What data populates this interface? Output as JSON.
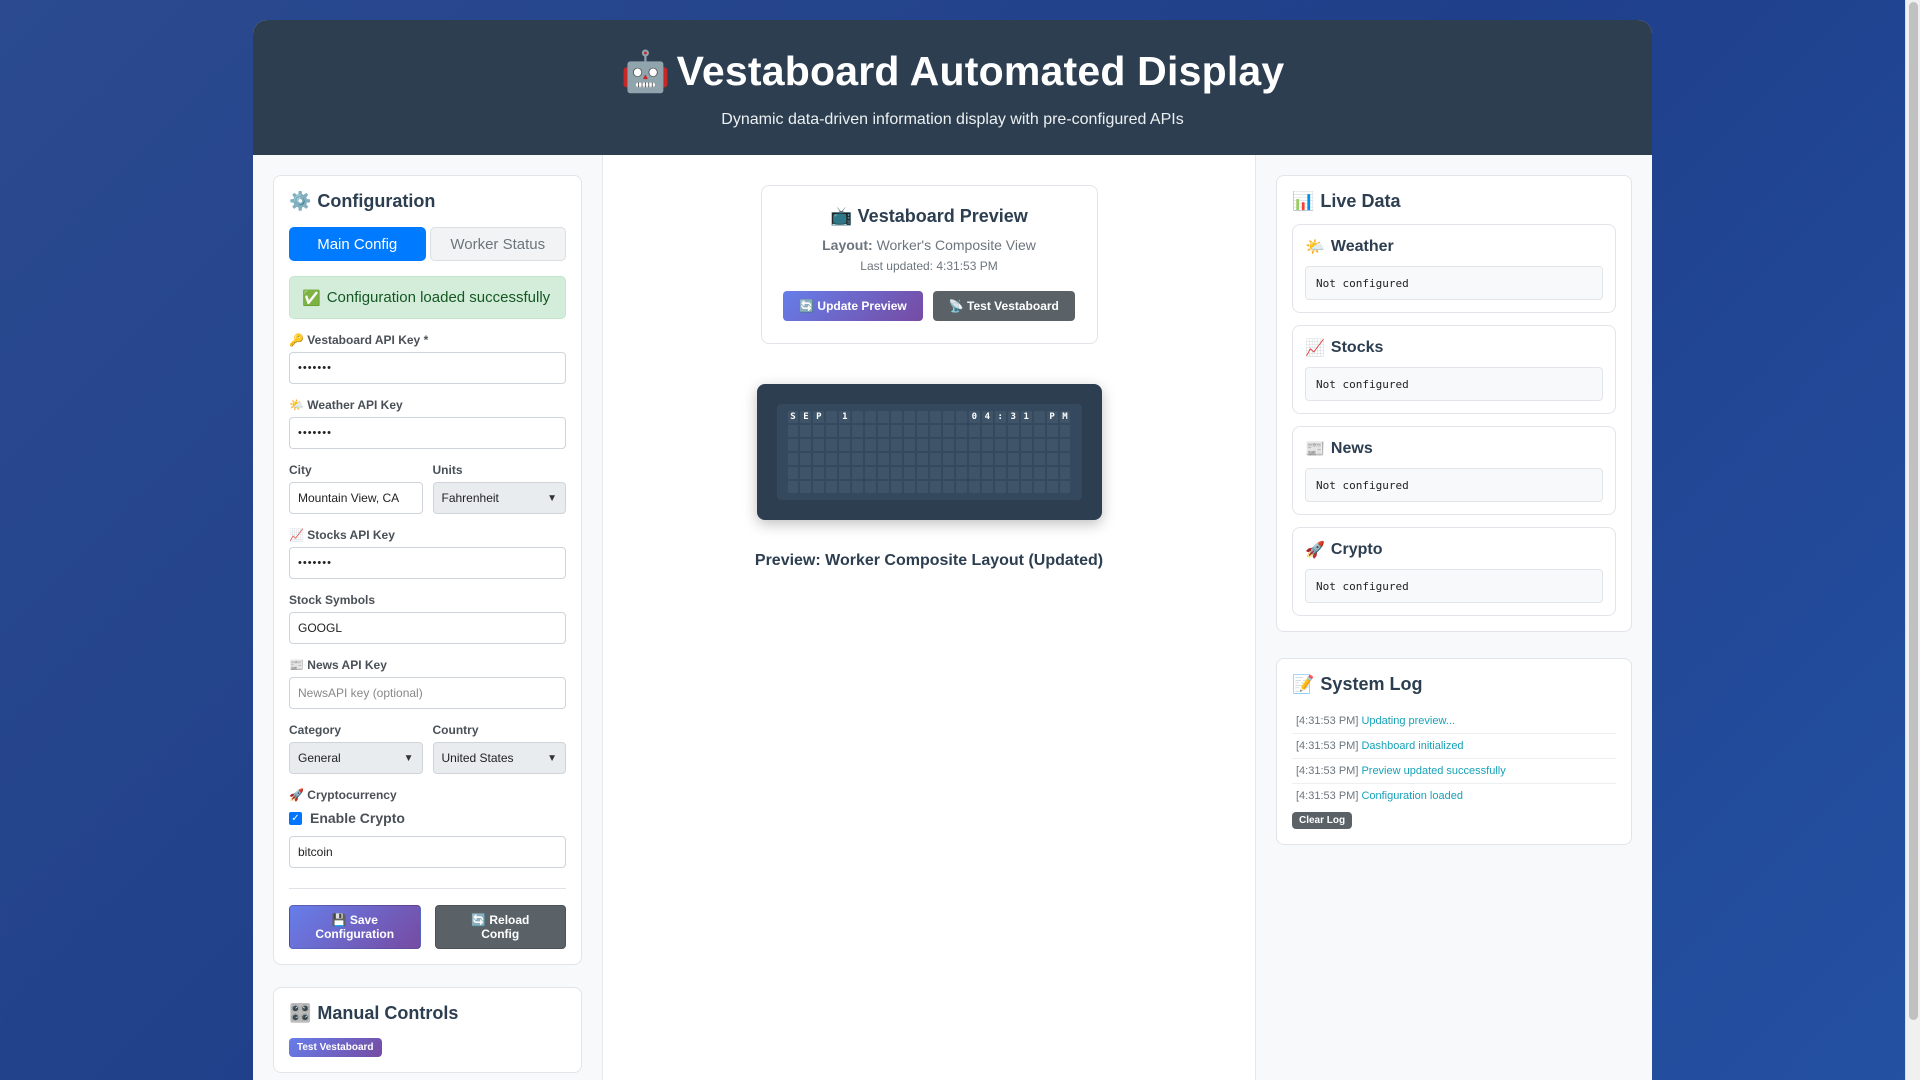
{
  "header": {
    "title": "Vestaboard Automated Display",
    "title_icon": "🤖",
    "subtitle": "Dynamic data-driven information display with pre-configured APIs"
  },
  "config": {
    "title": "Configuration",
    "icon": "⚙️",
    "tabs": [
      "Main Config",
      "Worker Status"
    ],
    "active_tab": 0,
    "alert": "Configuration loaded successfully",
    "alert_icon": "✅",
    "vestaboard_key_label": "Vestaboard API Key *",
    "vestaboard_key_value": "•••••••",
    "weather_key_label": "Weather API Key",
    "weather_key_value": "•••••••",
    "city_label": "City",
    "city_value": "Mountain View, CA",
    "units_label": "Units",
    "units_value": "Fahrenheit",
    "stocks_key_label": "Stocks API Key",
    "stocks_key_value": "•••••••",
    "symbols_label": "Stock Symbols",
    "symbols_value": "GOOGL",
    "news_key_label": "News API Key",
    "news_key_placeholder": "NewsAPI key (optional)",
    "category_label": "Category",
    "category_value": "General",
    "country_label": "Country",
    "country_value": "United States",
    "crypto_label": "Cryptocurrency",
    "crypto_enable_label": "Enable Crypto",
    "crypto_enabled": true,
    "crypto_value": "bitcoin",
    "save_label_1": "💾 Save",
    "save_label_2": "Configuration",
    "reload_label_1": "🔄 Reload",
    "reload_label_2": "Config"
  },
  "manual": {
    "title": "Manual Controls",
    "icon": "🎛️",
    "test_button": "Test Vestaboard"
  },
  "preview": {
    "title": "Vestaboard Preview",
    "icon": "📺",
    "layout_label": "Layout:",
    "layout_value": "Worker's Composite View",
    "last_updated": "Last updated: 4:31:53 PM",
    "update_button": "🔄 Update Preview",
    "test_button": "📡 Test Vestaboard",
    "board_rows": [
      "SEP 1         04:31 PM",
      "",
      "",
      "",
      "",
      ""
    ],
    "caption": "Preview: Worker Composite Layout (Updated)"
  },
  "live": {
    "title": "Live Data",
    "icon": "📊",
    "sections": [
      {
        "title": "Weather",
        "icon": "🌤️",
        "value": "Not configured"
      },
      {
        "title": "Stocks",
        "icon": "📈",
        "value": "Not configured"
      },
      {
        "title": "News",
        "icon": "📰",
        "value": "Not configured"
      },
      {
        "title": "Crypto",
        "icon": "🚀",
        "value": "Not configured"
      }
    ]
  },
  "log": {
    "title": "System Log",
    "icon": "📝",
    "entries": [
      {
        "ts": "[4:31:53 PM]",
        "msg": "Updating preview..."
      },
      {
        "ts": "[4:31:53 PM]",
        "msg": "Dashboard initialized"
      },
      {
        "ts": "[4:31:53 PM]",
        "msg": "Preview updated successfully"
      },
      {
        "ts": "[4:31:53 PM]",
        "msg": "Configuration loaded"
      }
    ],
    "clear_button": "Clear Log"
  },
  "icons": {
    "key": "🔑",
    "weather": "🌤️",
    "stocks": "📈",
    "news": "📰",
    "crypto": "🚀"
  }
}
